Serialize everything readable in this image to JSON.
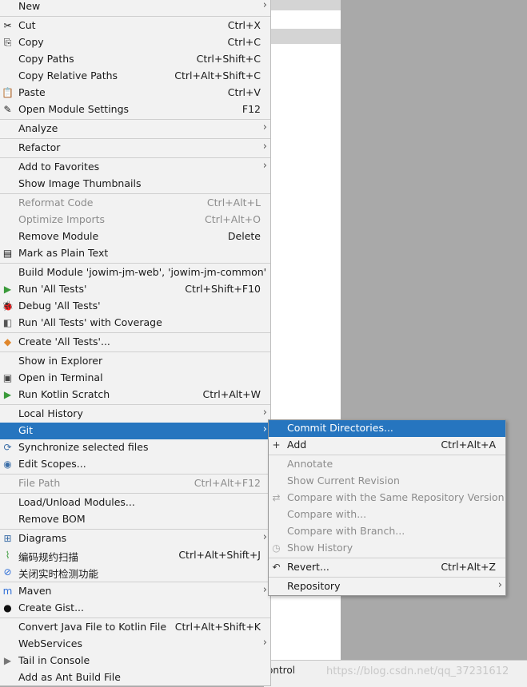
{
  "main_menu": [
    {
      "id": "new",
      "label": "New",
      "sub": true
    },
    {
      "sep": true
    },
    {
      "id": "cut",
      "label": "Cut",
      "sc": "Ctrl+X",
      "icon": "scissors-icon",
      "glyph": "✂"
    },
    {
      "id": "copy",
      "label": "Copy",
      "sc": "Ctrl+C",
      "icon": "copy-icon",
      "glyph": "⎘"
    },
    {
      "id": "copy-paths",
      "label": "Copy Paths",
      "sc": "Ctrl+Shift+C"
    },
    {
      "id": "copy-relative-paths",
      "label": "Copy Relative Paths",
      "sc": "Ctrl+Alt+Shift+C"
    },
    {
      "id": "paste",
      "label": "Paste",
      "sc": "Ctrl+V",
      "icon": "clipboard-icon",
      "glyph": "📋"
    },
    {
      "id": "open-module-settings",
      "label": "Open Module Settings",
      "sc": "F12",
      "icon": "edit-icon",
      "glyph": "✎"
    },
    {
      "sep": true
    },
    {
      "id": "analyze",
      "label": "Analyze",
      "sub": true
    },
    {
      "sep": true
    },
    {
      "id": "refactor",
      "label": "Refactor",
      "sub": true
    },
    {
      "sep": true
    },
    {
      "id": "add-to-favorites",
      "label": "Add to Favorites",
      "sub": true
    },
    {
      "id": "show-image-thumbnails",
      "label": "Show Image Thumbnails"
    },
    {
      "sep": true
    },
    {
      "id": "reformat-code",
      "label": "Reformat Code",
      "sc": "Ctrl+Alt+L",
      "disabled": true
    },
    {
      "id": "optimize-imports",
      "label": "Optimize Imports",
      "sc": "Ctrl+Alt+O",
      "disabled": true
    },
    {
      "id": "remove-module",
      "label": "Remove Module",
      "sc": "Delete"
    },
    {
      "id": "mark-as-plain-text",
      "label": "Mark as Plain Text",
      "icon": "text-file-icon",
      "glyph": "▤"
    },
    {
      "sep": true
    },
    {
      "id": "build-module",
      "label": "Build Module 'jowim-jm-web', 'jowim-jm-common'"
    },
    {
      "id": "run-all-tests",
      "label": "Run 'All Tests'",
      "sc": "Ctrl+Shift+F10",
      "icon": "run-icon",
      "glyph": "▶",
      "color": "#3a9a3a"
    },
    {
      "id": "debug-all-tests",
      "label": "Debug 'All Tests'",
      "icon": "debug-bug-icon",
      "glyph": "🐞",
      "color": "#3a9a3a"
    },
    {
      "id": "run-with-coverage",
      "label": "Run 'All Tests' with Coverage",
      "icon": "coverage-icon",
      "glyph": "◧",
      "color": "#555555"
    },
    {
      "sep": true
    },
    {
      "id": "create-all-tests",
      "label": "Create 'All Tests'...",
      "icon": "create-config-icon",
      "glyph": "◆",
      "color": "#e0862b"
    },
    {
      "sep": true
    },
    {
      "id": "show-in-explorer",
      "label": "Show in Explorer"
    },
    {
      "id": "open-in-terminal",
      "label": "Open in Terminal",
      "icon": "terminal-icon",
      "glyph": "▣",
      "color": "#444444"
    },
    {
      "id": "run-kotlin-scratch",
      "label": "Run Kotlin Scratch",
      "sc": "Ctrl+Alt+W",
      "icon": "run-icon",
      "glyph": "▶",
      "color": "#3a9a3a"
    },
    {
      "sep": true
    },
    {
      "id": "local-history",
      "label": "Local History",
      "sub": true
    },
    {
      "id": "git",
      "label": "Git",
      "sub": true,
      "selected": true
    },
    {
      "id": "synchronize-selected-files",
      "label": "Synchronize selected files",
      "icon": "sync-icon",
      "glyph": "⟳",
      "color": "#3d6fa8"
    },
    {
      "id": "edit-scopes",
      "label": "Edit Scopes...",
      "icon": "scope-icon",
      "glyph": "◉",
      "color": "#3d6fa8"
    },
    {
      "sep": true
    },
    {
      "id": "file-path",
      "label": "File Path",
      "sc": "Ctrl+Alt+F12",
      "disabled": true
    },
    {
      "sep": true
    },
    {
      "id": "load-unload-modules",
      "label": "Load/Unload Modules..."
    },
    {
      "id": "remove-bom",
      "label": "Remove BOM"
    },
    {
      "sep": true
    },
    {
      "id": "diagrams",
      "label": "Diagrams",
      "sub": true,
      "icon": "diagram-icon",
      "glyph": "⊞",
      "color": "#3d6fa8"
    },
    {
      "id": "code-scan",
      "label": "编码规约扫描",
      "sc": "Ctrl+Alt+Shift+J",
      "icon": "code-scan-icon",
      "glyph": "⌇",
      "color": "#3a9a3a"
    },
    {
      "id": "close-realtime-detect",
      "label": "关闭实时检测功能",
      "icon": "disable-icon",
      "glyph": "⊘",
      "color": "#2f6fd8"
    },
    {
      "sep": true
    },
    {
      "id": "maven",
      "label": "Maven",
      "sub": true,
      "icon": "maven-icon",
      "glyph": "m",
      "color": "#2f6fd8"
    },
    {
      "id": "create-gist",
      "label": "Create Gist...",
      "icon": "github-icon",
      "glyph": "●",
      "color": "#111111"
    },
    {
      "sep": true
    },
    {
      "id": "convert-java-to-kotlin",
      "label": "Convert Java File to Kotlin File",
      "sc": "Ctrl+Alt+Shift+K"
    },
    {
      "id": "webservices",
      "label": "WebServices",
      "sub": true
    },
    {
      "id": "tail-in-console",
      "label": "Tail in Console",
      "icon": "tail-icon",
      "glyph": "▶",
      "color": "#777777"
    },
    {
      "id": "add-as-ant-build-file",
      "label": "Add as Ant Build File"
    }
  ],
  "git_menu": [
    {
      "id": "commit-directories",
      "label": "Commit Directories...",
      "selected": true
    },
    {
      "id": "add",
      "label": "Add",
      "sc": "Ctrl+Alt+A",
      "icon": "plus-icon",
      "glyph": "+",
      "color": "#333333"
    },
    {
      "sep": true
    },
    {
      "id": "annotate",
      "label": "Annotate",
      "disabled": true
    },
    {
      "id": "show-current-revision",
      "label": "Show Current Revision",
      "disabled": true
    },
    {
      "id": "compare-same-repo",
      "label": "Compare with the Same Repository Version",
      "disabled": true,
      "icon": "compare-icon",
      "glyph": "⇄",
      "color": "#aaaaaa"
    },
    {
      "id": "compare-with",
      "label": "Compare with...",
      "disabled": true
    },
    {
      "id": "compare-with-branch",
      "label": "Compare with Branch...",
      "disabled": true
    },
    {
      "id": "show-history",
      "label": "Show History",
      "disabled": true,
      "icon": "history-clock-icon",
      "glyph": "◷",
      "color": "#aaaaaa"
    },
    {
      "sep": true
    },
    {
      "id": "revert",
      "label": "Revert...",
      "sc": "Ctrl+Alt+Z",
      "icon": "revert-icon",
      "glyph": "↶",
      "color": "#333333"
    },
    {
      "sep": true
    },
    {
      "id": "repository",
      "label": "Repository",
      "sub": true
    }
  ],
  "background": {
    "bottom_text": "ontrol",
    "watermark": "https://blog.csdn.net/qq_37231612"
  }
}
